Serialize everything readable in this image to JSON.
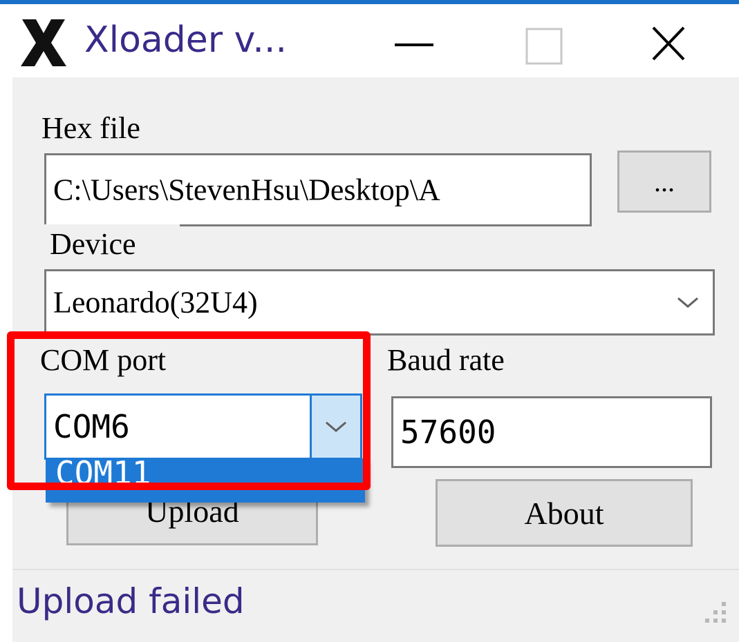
{
  "window": {
    "title": "Xloader v...",
    "accent_color": "#1a6fc9",
    "controls": {
      "minimize_icon": "minimize-icon",
      "maximize_icon": "maximize-icon",
      "close_icon": "close-icon"
    }
  },
  "form": {
    "hex_file_label": "Hex file",
    "hex_file_value": "C:\\Users\\StevenHsu\\Desktop\\A",
    "browse_label": "...",
    "device_label": "Device",
    "device_value": "Leonardo(32U4)",
    "com_port_label": "COM port",
    "com_port_value": "COM6",
    "com_port_dropdown_items": [
      "COM11"
    ],
    "baud_rate_label": "Baud rate",
    "baud_rate_value": "57600",
    "upload_label": "Upload",
    "about_label": "About"
  },
  "status": {
    "text": "Upload failed"
  },
  "annotation": {
    "highlight_color": "#ff0000"
  }
}
